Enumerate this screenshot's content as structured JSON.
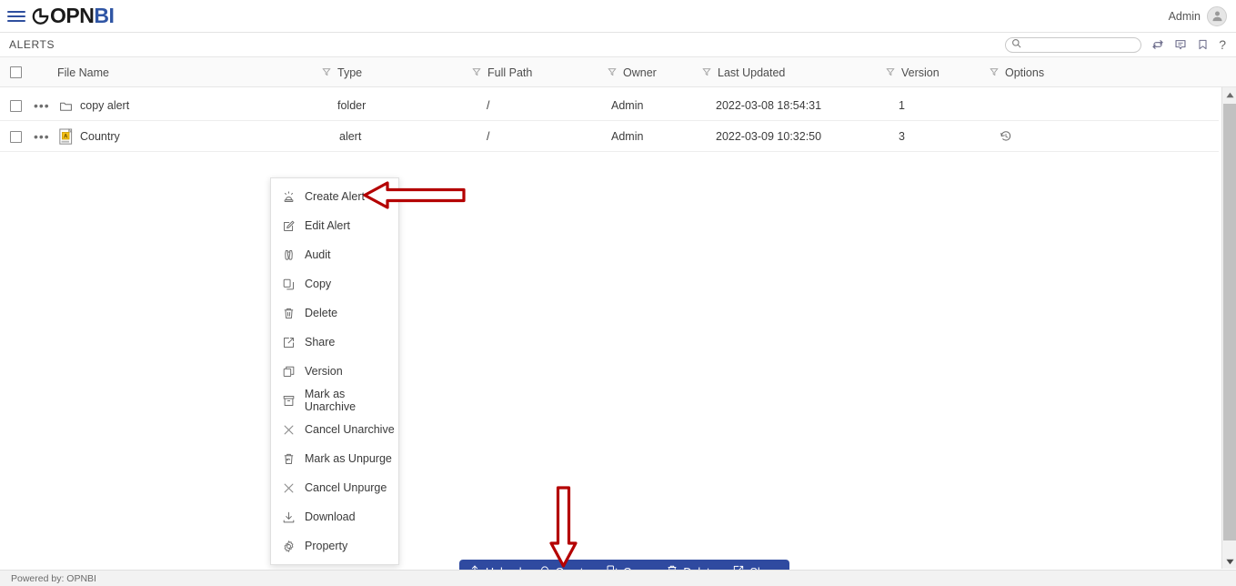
{
  "app": {
    "logo_dark": "OPN",
    "logo_blue": "BI",
    "menu_icon": "hamburger-icon"
  },
  "topbar": {
    "user_label": "Admin",
    "avatar_icon": "user-avatar-icon"
  },
  "subbar": {
    "title": "ALERTS",
    "search_placeholder": "",
    "search_value": "",
    "icons": [
      {
        "name": "refresh-icon",
        "title": "Refresh"
      },
      {
        "name": "comment-icon",
        "title": "Comments"
      },
      {
        "name": "bookmark-icon",
        "title": "Bookmark"
      },
      {
        "name": "help-icon",
        "title": "?"
      }
    ]
  },
  "table": {
    "columns": [
      {
        "label": "File Name",
        "filter": false
      },
      {
        "label": "Type",
        "filter": true
      },
      {
        "label": "Full Path",
        "filter": true
      },
      {
        "label": "Owner",
        "filter": true
      },
      {
        "label": "Last Updated",
        "filter": true
      },
      {
        "label": "Version",
        "filter": true
      },
      {
        "label": "Options",
        "filter": true
      }
    ],
    "rows": [
      {
        "icon": "folder-icon",
        "file_name": "copy alert",
        "type": "folder",
        "full_path": "/",
        "owner": "Admin",
        "last_updated": "2022-03-08 18:54:31",
        "version": "1",
        "options_icon": ""
      },
      {
        "icon": "alert-file-icon",
        "file_name": "Country",
        "type": "alert",
        "full_path": "/",
        "owner": "Admin",
        "last_updated": "2022-03-09 10:32:50",
        "version": "3",
        "options_icon": "history-icon"
      }
    ]
  },
  "context_menu": {
    "items": [
      {
        "label": "Create Alert",
        "icon": "siren-icon"
      },
      {
        "label": "Edit Alert",
        "icon": "edit-pencil-icon"
      },
      {
        "label": "Audit",
        "icon": "binoculars-icon"
      },
      {
        "label": "Copy",
        "icon": "copy-icon"
      },
      {
        "label": "Delete",
        "icon": "trash-icon"
      },
      {
        "label": "Share",
        "icon": "share-icon"
      },
      {
        "label": "Version",
        "icon": "version-icon"
      },
      {
        "label": "Mark as Unarchive",
        "icon": "archive-box-icon"
      },
      {
        "label": "Cancel Unarchive",
        "icon": "close-x-icon"
      },
      {
        "label": "Mark as Unpurge",
        "icon": "trash-restore-icon"
      },
      {
        "label": "Cancel Unpurge",
        "icon": "close-x-icon"
      },
      {
        "label": "Download",
        "icon": "download-icon"
      },
      {
        "label": "Property",
        "icon": "gear-icon"
      }
    ]
  },
  "action_bar": {
    "background": "#2f4aa0",
    "buttons": [
      {
        "label": "Upload",
        "icon": "upload-icon"
      },
      {
        "label": "Create",
        "icon": "bell-icon"
      },
      {
        "label": "Copy",
        "icon": "copy-icon"
      },
      {
        "label": "Delete",
        "icon": "trash-icon"
      },
      {
        "label": "Share",
        "icon": "share-icon"
      }
    ]
  },
  "footer": {
    "text": "Powered by: OPNBI"
  },
  "annotations": {
    "color": "#b40000",
    "arrows": [
      {
        "name": "arrow-to-create-alert",
        "direction": "left"
      },
      {
        "name": "arrow-to-create-button",
        "direction": "down"
      }
    ]
  }
}
